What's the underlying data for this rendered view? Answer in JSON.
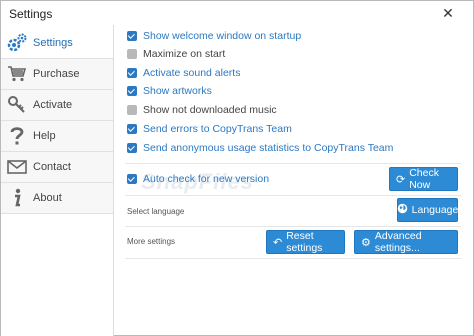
{
  "window": {
    "title": "Settings",
    "close_symbol": "✕"
  },
  "sidebar": {
    "items": [
      {
        "label": "Settings",
        "icon": "gears-icon",
        "active": true
      },
      {
        "label": "Purchase",
        "icon": "cart-icon",
        "active": false
      },
      {
        "label": "Activate",
        "icon": "key-icon",
        "active": false
      },
      {
        "label": "Help",
        "icon": "question-icon",
        "active": false
      },
      {
        "label": "Contact",
        "icon": "envelope-icon",
        "active": false
      },
      {
        "label": "About",
        "icon": "info-icon",
        "active": false
      }
    ]
  },
  "options": [
    {
      "label": "Show welcome window on startup",
      "checked": true
    },
    {
      "label": "Maximize on start",
      "checked": false
    },
    {
      "label": "Activate sound alerts",
      "checked": true
    },
    {
      "label": "Show artworks",
      "checked": true
    },
    {
      "label": "Show not downloaded music",
      "checked": false
    },
    {
      "label": "Send errors to CopyTrans Team",
      "checked": true
    },
    {
      "label": "Send anonymous usage statistics to CopyTrans Team",
      "checked": true
    }
  ],
  "update": {
    "label": "Auto check for new version",
    "checked": true,
    "button": "Check Now"
  },
  "language": {
    "label": "Select language",
    "button": "Language"
  },
  "more": {
    "label": "More settings",
    "reset_button": "Reset settings",
    "advanced_button": "Advanced settings..."
  },
  "watermark": "SnapFiles",
  "colors": {
    "accent": "#2b79c2",
    "button": "#2d8bd6",
    "unchecked": "#b9b9b9"
  }
}
